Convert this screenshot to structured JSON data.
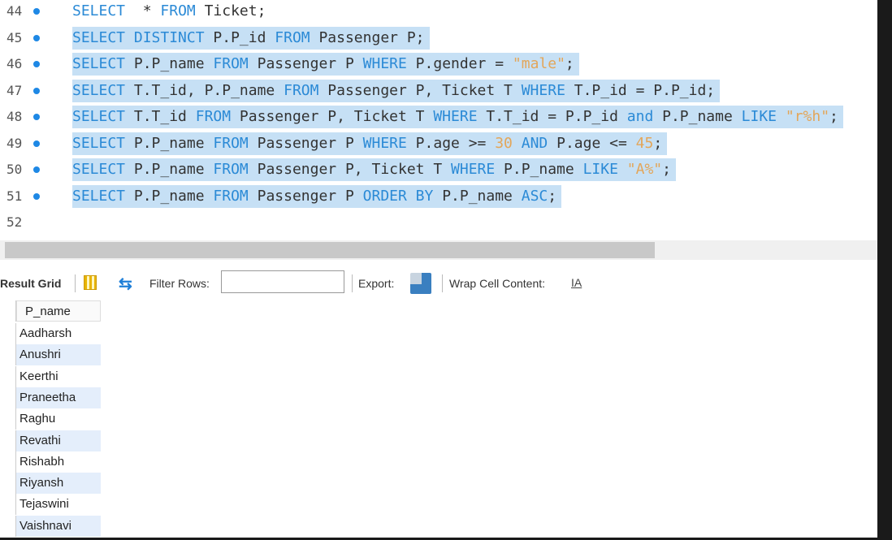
{
  "editor": {
    "lines": [
      {
        "n": "44",
        "sel": false,
        "t": [
          [
            "kw",
            "SELECT"
          ],
          [
            "",
            "  * "
          ],
          [
            "kw",
            "FROM"
          ],
          [
            "",
            " Ticket;"
          ]
        ]
      },
      {
        "n": "45",
        "sel": true,
        "t": [
          [
            "kw",
            "SELECT DISTINCT"
          ],
          [
            "",
            " P.P_id "
          ],
          [
            "kw",
            "FROM"
          ],
          [
            "",
            " Passenger P;"
          ]
        ]
      },
      {
        "n": "46",
        "sel": true,
        "t": [
          [
            "kw",
            "SELECT"
          ],
          [
            "",
            " P.P_name "
          ],
          [
            "kw",
            "FROM"
          ],
          [
            "",
            " Passenger P "
          ],
          [
            "kw",
            "WHERE"
          ],
          [
            "",
            " P.gender = "
          ],
          [
            "str",
            "\"male\""
          ],
          [
            "",
            ";"
          ]
        ]
      },
      {
        "n": "47",
        "sel": true,
        "t": [
          [
            "kw",
            "SELECT"
          ],
          [
            "",
            " T.T_id, P.P_name "
          ],
          [
            "kw",
            "FROM"
          ],
          [
            "",
            " Passenger P, Ticket T "
          ],
          [
            "kw",
            "WHERE"
          ],
          [
            "",
            " T.P_id = P.P_id;"
          ]
        ]
      },
      {
        "n": "48",
        "sel": true,
        "t": [
          [
            "kw",
            "SELECT"
          ],
          [
            "",
            " T.T_id "
          ],
          [
            "kw",
            "FROM"
          ],
          [
            "",
            " Passenger P, Ticket T "
          ],
          [
            "kw",
            "WHERE"
          ],
          [
            "",
            " T.T_id = P.P_id "
          ],
          [
            "kw",
            "and"
          ],
          [
            "",
            " P.P_name "
          ],
          [
            "kw",
            "LIKE"
          ],
          [
            "",
            " "
          ],
          [
            "str",
            "\"r%h\""
          ],
          [
            "",
            ";"
          ]
        ]
      },
      {
        "n": "49",
        "sel": true,
        "t": [
          [
            "kw",
            "SELECT"
          ],
          [
            "",
            " P.P_name "
          ],
          [
            "kw",
            "FROM"
          ],
          [
            "",
            " Passenger P "
          ],
          [
            "kw",
            "WHERE"
          ],
          [
            "",
            " P.age >= "
          ],
          [
            "num",
            "30"
          ],
          [
            "",
            " "
          ],
          [
            "kw",
            "AND"
          ],
          [
            "",
            " P.age <= "
          ],
          [
            "num",
            "45"
          ],
          [
            "",
            ";"
          ]
        ]
      },
      {
        "n": "50",
        "sel": true,
        "t": [
          [
            "kw",
            "SELECT"
          ],
          [
            "",
            " P.P_name "
          ],
          [
            "kw",
            "FROM"
          ],
          [
            "",
            " Passenger P, Ticket T "
          ],
          [
            "kw",
            "WHERE"
          ],
          [
            "",
            " P.P_name "
          ],
          [
            "kw",
            "LIKE"
          ],
          [
            "",
            " "
          ],
          [
            "str",
            "\"A%\""
          ],
          [
            "",
            ";"
          ]
        ]
      },
      {
        "n": "51",
        "sel": true,
        "t": [
          [
            "kw",
            "SELECT"
          ],
          [
            "",
            " P.P_name "
          ],
          [
            "kw",
            "FROM"
          ],
          [
            "",
            " Passenger P "
          ],
          [
            "kw",
            "ORDER BY"
          ],
          [
            "",
            " P.P_name "
          ],
          [
            "kw",
            "ASC"
          ],
          [
            "",
            ";"
          ]
        ]
      },
      {
        "n": "52",
        "sel": false,
        "t": []
      }
    ]
  },
  "toolbar": {
    "result_grid": "Result Grid",
    "filter_rows": "Filter Rows:",
    "filter_value": "",
    "export": "Export:",
    "wrap": "Wrap Cell Content:"
  },
  "grid": {
    "column": "P_name",
    "rows": [
      "Aadharsh",
      "Anushri",
      "Keerthi",
      "Praneetha",
      "Raghu",
      "Revathi",
      "Rishabh",
      "Riyansh",
      "Tejaswini",
      "Vaishnavi"
    ]
  },
  "colors": {
    "keyword": "#2b8ad6",
    "string": "#e3a65a",
    "selection": "#c6e0f5"
  }
}
